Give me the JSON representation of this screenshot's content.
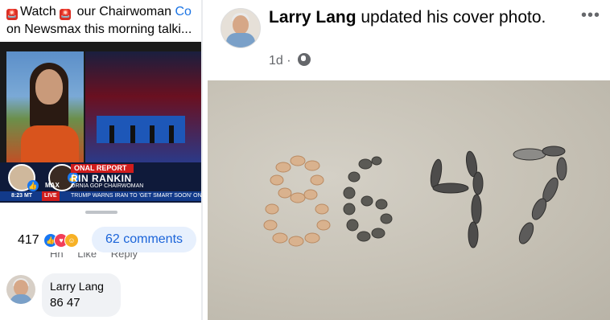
{
  "left_post": {
    "emoji_1": "🚨",
    "line1_a": "Watch",
    "emoji_2": "🚨",
    "line1_b": " our Chairwoman ",
    "mention": "Co",
    "line2": "on Newsmax this morning talki..."
  },
  "video": {
    "report_tag": "ONAL REPORT",
    "name": "RIN RANKIN",
    "role": "ORNIA GOP CHAIRWOMAN",
    "time": "8:23 MT",
    "live": "LIVE",
    "channel": "MAX",
    "ticker": "TRUMP WARNS IRAN TO 'GET SMART SOON' ON DEAL"
  },
  "reactions": {
    "count": "417",
    "comments": "62 comments",
    "cut_actions": [
      "Hh",
      "Like",
      "Reply"
    ]
  },
  "comment": {
    "name": "Larry Lang",
    "text": "86 47"
  },
  "right_post": {
    "author": "Larry Lang",
    "action": " updated his cover photo.",
    "time": "1d",
    "more": "•••"
  }
}
